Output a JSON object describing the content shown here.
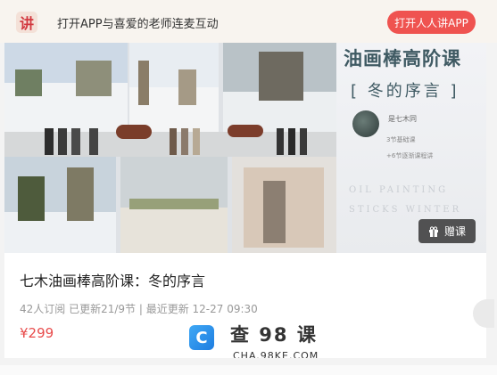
{
  "topbar": {
    "logo_text": "讲",
    "message": "打开APP与喜爱的老师连麦互动",
    "open_app_label": "打开人人讲APP",
    "accent": "#ef5350"
  },
  "cover": {
    "title": "油画棒高阶课",
    "subtitle": "[ 冬的序言 ]",
    "teacher_name": "是七木同",
    "teacher_line1": "3节基础课",
    "teacher_line2": "+6节逐渐课程讲",
    "english_line1": "OIL PAINTING",
    "english_line2": "STICKS WINTER",
    "gift_label": "赠课",
    "gift_icon": "gift-icon"
  },
  "course": {
    "title": "七木油画棒高阶课：冬的序言",
    "meta": "42人订阅   已更新21/9节 | 最近更新 12-27 09:30",
    "price": "¥299",
    "price_color": "#e84b4b"
  },
  "watermark": {
    "icon_glyph": "C",
    "text": "查 98 课",
    "sub": "CHA.98KE.COM"
  }
}
